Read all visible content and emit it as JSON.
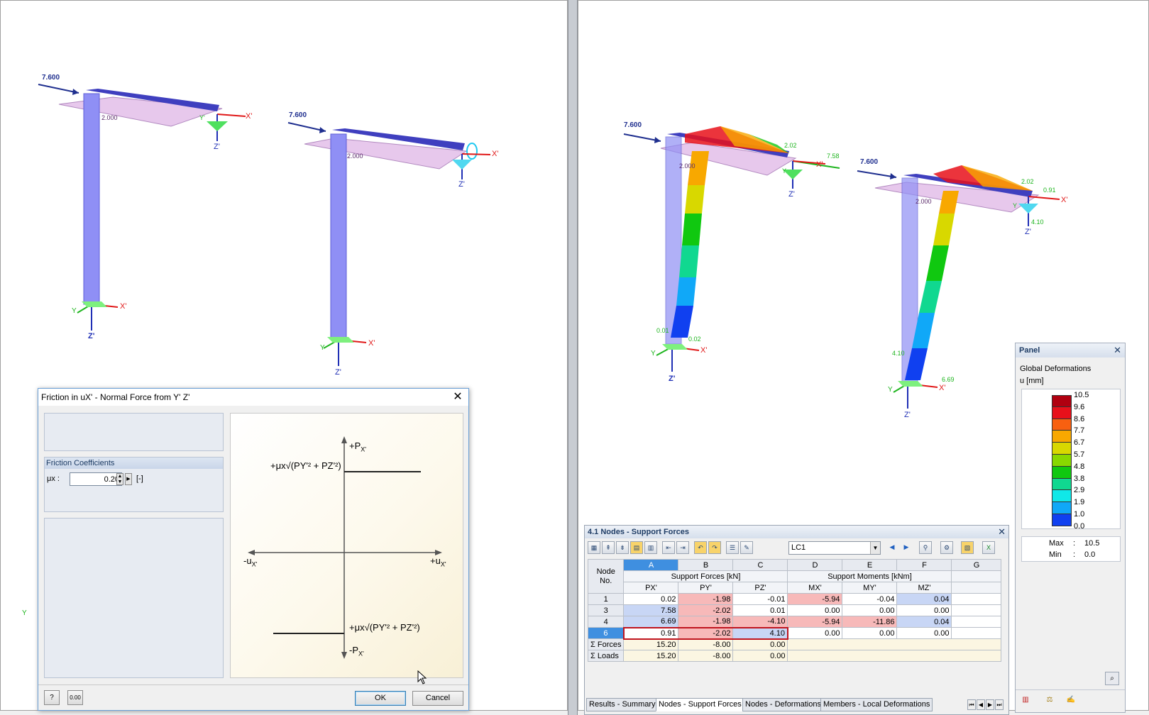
{
  "colors": {
    "member_fill": "#8f8ff5",
    "beam_top": "#3f3fbf",
    "plane_fill": "#e7c8ec",
    "load_arrow": "#1f2f8f",
    "axis_red": "#e01818",
    "axis_blue": "#1f2fb5",
    "axis_green": "#1fb51f",
    "selection_red": "#c0141e",
    "neg_cell": "#f7b9b9",
    "pos_cell": "#c8d6f5",
    "dialog_border": "#6a9fd6"
  },
  "model_left": {
    "load_labels": [
      "7.600",
      "7.600"
    ],
    "dimension_labels": [
      "2.000",
      "2.000"
    ],
    "axis_labels": [
      "X'",
      "Z'",
      "Y'",
      "X'",
      "Z'",
      "X'",
      "Z'",
      "X'",
      "Z'",
      "Y",
      "Y",
      "Y"
    ]
  },
  "model_right": {
    "load_labels": [
      "7.600",
      "7.600"
    ],
    "dimension_labels": [
      "2.000",
      "2.000"
    ],
    "result_labels": [
      "2.02",
      "7.58",
      "2.02",
      "0.91",
      "4.10",
      "0.01",
      "0.02",
      "4.10",
      "6.69"
    ],
    "axis_labels": [
      "X'",
      "Z'",
      "X'",
      "Z'",
      "X'",
      "Z'",
      "X'",
      "Z'",
      "Y",
      "Y",
      "Y",
      "Y"
    ]
  },
  "dialog": {
    "title": "Friction in uX' - Normal Force from Y' Z'",
    "group_title": "Friction Coefficients",
    "mu_label": "μx :",
    "mu_value": "0.20",
    "mu_unit": "[-]",
    "graph": {
      "plus_p": "+P",
      "plus_p_sub": "X'",
      "minus_p": "-P",
      "minus_p_sub": "X'",
      "minus_u": "-u",
      "minus_u_sub": "X'",
      "plus_u": "+u",
      "plus_u_sub": "X'",
      "formula_top": "+μx√(PY'² + PZ'²)",
      "formula_bottom": "+μx√(PY'² + PZ'²)"
    },
    "ok_label": "OK",
    "cancel_label": "Cancel",
    "help_icon": "help-icon",
    "units_icon": "units-icon",
    "units_text": "0.00"
  },
  "table_window": {
    "title": "4.1 Nodes - Support Forces",
    "load_case": "LC1",
    "col_letters": [
      "A",
      "B",
      "C",
      "D",
      "E",
      "F",
      "G"
    ],
    "node_header": "Node\nNo.",
    "group_forces": "Support Forces [kN]",
    "group_moments": "Support Moments [kNm]",
    "sub_headers": [
      "PX'",
      "PY'",
      "PZ'",
      "MX'",
      "MY'",
      "MZ'"
    ],
    "rows": [
      {
        "node": "1",
        "vals": [
          "0.02",
          "-1.98",
          "-0.01",
          "-5.94",
          "-0.04",
          "0.04"
        ]
      },
      {
        "node": "3",
        "vals": [
          "7.58",
          "-2.02",
          "0.01",
          "0.00",
          "0.00",
          "0.00"
        ]
      },
      {
        "node": "4",
        "vals": [
          "6.69",
          "-1.98",
          "-4.10",
          "-5.94",
          "-11.86",
          "0.04"
        ]
      },
      {
        "node": "6",
        "vals": [
          "0.91",
          "-2.02",
          "4.10",
          "0.00",
          "0.00",
          "0.00"
        ]
      }
    ],
    "sum_rows": [
      {
        "label": "Σ Forces",
        "vals": [
          "15.20",
          "-8.00",
          "0.00"
        ]
      },
      {
        "label": "Σ Loads",
        "vals": [
          "15.20",
          "-8.00",
          "0.00"
        ]
      }
    ],
    "tabs": [
      "Results - Summary",
      "Nodes - Support Forces",
      "Nodes - Deformations",
      "Members - Local Deformations"
    ],
    "active_tab": 1
  },
  "panel": {
    "title": "Panel",
    "result_name": "Global Deformations",
    "unit": "u [mm]",
    "scale": [
      {
        "value": "10.5",
        "color": "#b00010"
      },
      {
        "value": "9.6",
        "color": "#e8101a"
      },
      {
        "value": "8.6",
        "color": "#f86010"
      },
      {
        "value": "7.7",
        "color": "#f8a800"
      },
      {
        "value": "6.7",
        "color": "#d8d800"
      },
      {
        "value": "5.7",
        "color": "#88d800"
      },
      {
        "value": "4.8",
        "color": "#10c810"
      },
      {
        "value": "3.8",
        "color": "#10d890"
      },
      {
        "value": "2.9",
        "color": "#10e8e8"
      },
      {
        "value": "1.9",
        "color": "#10a8f8"
      },
      {
        "value": "1.0",
        "color": "#1040f0"
      },
      {
        "value": "0.0",
        "color": "#0a0aa0"
      }
    ],
    "max_label": "Max",
    "max_value": "10.5",
    "min_label": "Min",
    "min_value": "0.0"
  }
}
